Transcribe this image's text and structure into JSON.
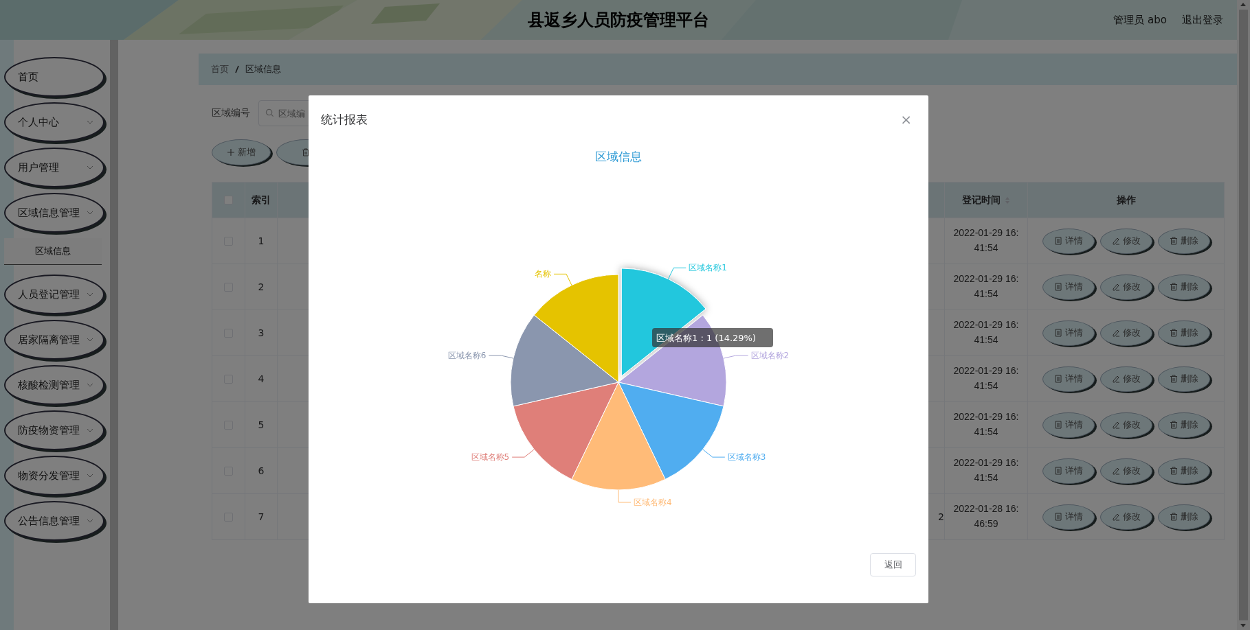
{
  "header": {
    "title": "县返乡人员防疫管理平台",
    "user": "管理员 abo",
    "logout": "退出登录"
  },
  "sidebar": {
    "items": [
      {
        "label": "首页",
        "kind": "link"
      },
      {
        "label": "个人中心",
        "kind": "submenu"
      },
      {
        "label": "用户管理",
        "kind": "submenu"
      },
      {
        "label": "区域信息管理",
        "kind": "submenu",
        "children": [
          {
            "label": "区域信息",
            "selected": true
          }
        ]
      },
      {
        "label": "人员登记管理",
        "kind": "submenu"
      },
      {
        "label": "居家隔离管理",
        "kind": "submenu"
      },
      {
        "label": "核酸检测管理",
        "kind": "submenu"
      },
      {
        "label": "防疫物资管理",
        "kind": "submenu"
      },
      {
        "label": "物资分发管理",
        "kind": "submenu"
      },
      {
        "label": "公告信息管理",
        "kind": "submenu"
      }
    ]
  },
  "breadcrumb": [
    "首页",
    "区域信息"
  ],
  "search": {
    "label": "区域编号",
    "placeholder": "区域编"
  },
  "toolbar": [
    {
      "label": "新增",
      "kind": "add"
    },
    {
      "kind": "delete"
    }
  ],
  "table": {
    "select_all_checked": false,
    "columns": {
      "index": "索引",
      "time": "登记时间",
      "actions": "操作"
    },
    "rows": [
      {
        "index": "1",
        "time": "2022-01-29 16:41:54",
        "checked": false,
        "actions": [
          {
            "label": "详情",
            "kind": "detail"
          },
          {
            "label": "修改",
            "kind": "edit"
          },
          {
            "label": "删除",
            "kind": "delete"
          }
        ]
      },
      {
        "index": "2",
        "time": "2022-01-29 16:41:54",
        "checked": false,
        "actions": [
          {
            "label": "详情",
            "kind": "detail"
          },
          {
            "label": "修改",
            "kind": "edit"
          },
          {
            "label": "删除",
            "kind": "delete"
          }
        ]
      },
      {
        "index": "3",
        "time": "2022-01-29 16:41:54",
        "checked": false,
        "actions": [
          {
            "label": "详情",
            "kind": "detail"
          },
          {
            "label": "修改",
            "kind": "edit"
          },
          {
            "label": "删除",
            "kind": "delete"
          }
        ]
      },
      {
        "index": "4",
        "time": "2022-01-29 16:41:54",
        "checked": false,
        "actions": [
          {
            "label": "详情",
            "kind": "detail"
          },
          {
            "label": "修改",
            "kind": "edit"
          },
          {
            "label": "删除",
            "kind": "delete"
          }
        ]
      },
      {
        "index": "5",
        "time": "2022-01-29 16:41:54",
        "checked": false,
        "actions": [
          {
            "label": "详情",
            "kind": "detail"
          },
          {
            "label": "修改",
            "kind": "edit"
          },
          {
            "label": "删除",
            "kind": "delete"
          }
        ]
      },
      {
        "index": "6",
        "time": "2022-01-29 16:41:54",
        "checked": false,
        "actions": [
          {
            "label": "详情",
            "kind": "detail"
          },
          {
            "label": "修改",
            "kind": "edit"
          },
          {
            "label": "删除",
            "kind": "delete"
          }
        ]
      },
      {
        "index": "7",
        "partial": "2",
        "time": "2022-01-28 16:46:59",
        "checked": false,
        "actions": [
          {
            "label": "详情",
            "kind": "detail"
          },
          {
            "label": "修改",
            "kind": "edit"
          },
          {
            "label": "删除",
            "kind": "delete"
          }
        ]
      }
    ]
  },
  "dialog": {
    "title": "统计报表",
    "close": "×",
    "button": "返回",
    "chart": {
      "chart_data": {
        "type": "pie",
        "title": "区域信息",
        "categories": [
          "区域名称1",
          "区域名称2",
          "区域名称3",
          "区域名称4",
          "区域名称5",
          "区域名称6",
          "名称"
        ],
        "series": [
          {
            "values": [
              1,
              1,
              1,
              1,
              1,
              1,
              1
            ]
          }
        ],
        "colors": [
          "#22c7dd",
          "#b3a6de",
          "#50adf0",
          "#ffbb78",
          "#df7f79",
          "#8a96ae",
          "#e5c300"
        ]
      },
      "slices": [
        {
          "hovered": true
        },
        {
          "hovered": false
        },
        {
          "hovered": false
        },
        {
          "hovered": false
        },
        {
          "hovered": false
        },
        {
          "hovered": false
        },
        {
          "hovered": false
        }
      ],
      "tooltip": "区域名称1 : 1 (14.29%)"
    }
  }
}
